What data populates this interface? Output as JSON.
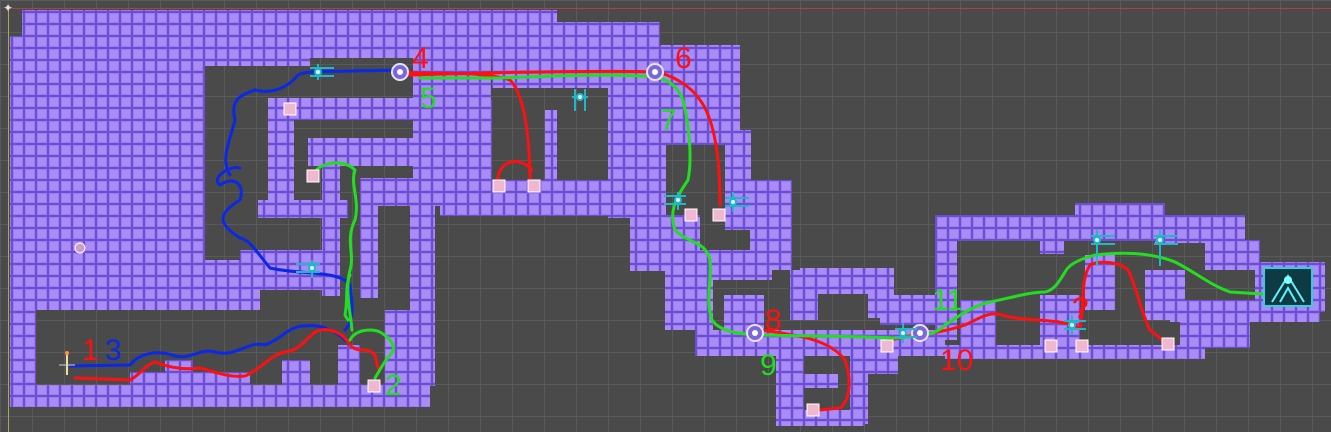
{
  "scene": {
    "tile_fill": "#9b7cf0",
    "tile_edge": "#6b4fd0",
    "grid_color": "#5a5a5a",
    "background": "#4a4a4a"
  },
  "route_colors": {
    "red": "#ff1010",
    "blue": "#0a28e6",
    "green": "#22dd22"
  },
  "route_labels": [
    {
      "text": "1",
      "color": "#ff1010"
    },
    {
      "text": "3",
      "color": "#0a28e6"
    },
    {
      "text": "2",
      "color": "#22dd22"
    },
    {
      "text": "4",
      "color": "#ff1010"
    },
    {
      "text": "5",
      "color": "#22dd22"
    },
    {
      "text": "6",
      "color": "#ff1010"
    },
    {
      "text": "7",
      "color": "#22dd22"
    },
    {
      "text": "8",
      "color": "#ff1010"
    },
    {
      "text": "9",
      "color": "#22dd22"
    },
    {
      "text": "10",
      "color": "#ff1010"
    },
    {
      "text": "11",
      "color": "#22dd22"
    },
    {
      "text": "?",
      "color": "#ff1010"
    }
  ],
  "icons": {
    "player_start": "player-start-icon",
    "pickup": "pickup-icon",
    "portal": "portal-node-icon",
    "mover": "mover-arrows-icon",
    "exit": "exit-gate-icon"
  }
}
